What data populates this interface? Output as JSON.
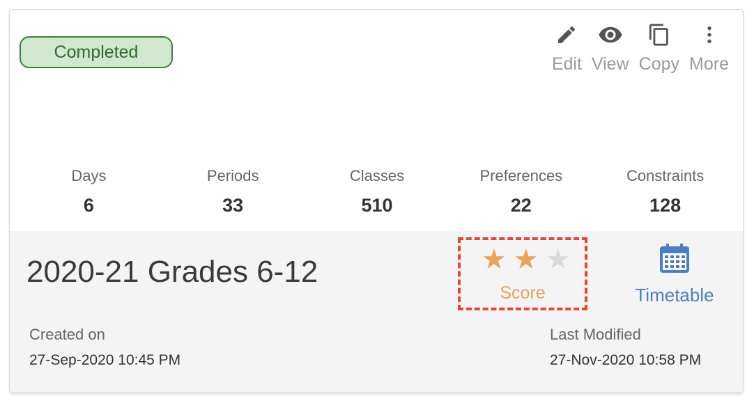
{
  "status": {
    "label": "Completed"
  },
  "actions": [
    {
      "label": "Edit",
      "icon": "pencil-icon"
    },
    {
      "label": "View",
      "icon": "eye-icon"
    },
    {
      "label": "Copy",
      "icon": "copy-icon"
    },
    {
      "label": "More",
      "icon": "more-vertical-icon"
    }
  ],
  "stats": [
    {
      "label": "Days",
      "value": "6"
    },
    {
      "label": "Periods",
      "value": "33"
    },
    {
      "label": "Classes",
      "value": "510"
    },
    {
      "label": "Preferences",
      "value": "22"
    },
    {
      "label": "Constraints",
      "value": "128"
    }
  ],
  "timetable_name": "2020-21 Grades 6-12",
  "score": {
    "label": "Score",
    "rating": 2,
    "max": 3
  },
  "timetable_link": {
    "label": "Timetable",
    "icon": "calendar-icon"
  },
  "created": {
    "label": "Created on",
    "value": "27-Sep-2020 10:45 PM"
  },
  "modified": {
    "label": "Last Modified",
    "value": "27-Nov-2020 10:58 PM"
  },
  "colors": {
    "badge_bg": "#cfe8ce",
    "badge_border": "#3f7d3a",
    "star_filled": "#e9a35a",
    "star_empty": "#d9d9d9",
    "link": "#4a7fc7",
    "highlight": "#e8442f"
  }
}
